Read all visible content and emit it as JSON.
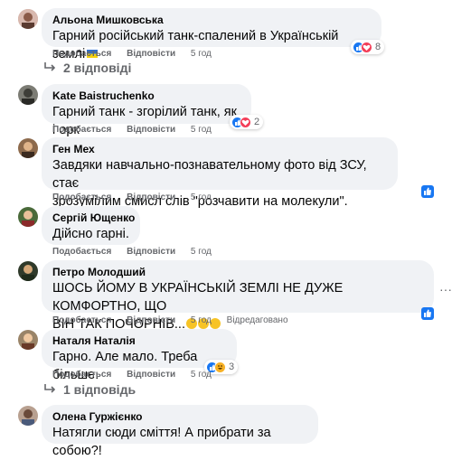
{
  "comments": [
    {
      "author": "Альона Мишковська",
      "text": "Гарний російський танк-спалений в Українській землі",
      "flag": "ukraine-flag",
      "actions": {
        "like": "Подобається",
        "reply": "Відповісти",
        "time": "5 год"
      },
      "reactions": {
        "count": "8",
        "icons": [
          "like-icon",
          "love-icon"
        ]
      },
      "replies": "2 відповіді"
    },
    {
      "author": "Kate Baistruchenko",
      "text": "Гарний танк - згорілий танк, як і орк",
      "actions": {
        "like": "Подобається",
        "reply": "Відповісти",
        "time": "5 год"
      },
      "reactions": {
        "count": "2",
        "icons": [
          "like-icon",
          "love-icon"
        ]
      }
    },
    {
      "author": "Ген Мех",
      "text_lines": [
        "Завдяки навчально-познавательному фото від ЗСУ, стає",
        "зрозумілим смисл слів \"розчавити на молекули\"."
      ],
      "actions": {
        "like": "Подобається",
        "reply": "Відповісти",
        "time": "5 год"
      }
    },
    {
      "author": "Сергій Ющенко",
      "text": "Дійсно гарні.",
      "actions": {
        "like": "Подобається",
        "reply": "Відповісти",
        "time": "5 год"
      }
    },
    {
      "author": "Петро Молодший",
      "text_lines": [
        "ШОСЬ ЙОМУ В УКРАЇНСЬКІЙ ЗЕМЛІ НЕ ДУЖЕ КОМФОРТНО, ЩО",
        "ВІН ТАК ПОЧОРНІВ..."
      ],
      "emojis": [
        "laughing-crying-emoji",
        "laughing-crying-emoji",
        "laughing-crying-emoji"
      ],
      "actions": {
        "like": "Подобається",
        "reply": "Відповісти",
        "time": "5 год",
        "edited": "Відредаговано"
      }
    },
    {
      "author": "Наталя Наталія",
      "text": "Гарно. Але мало. Треба більше.",
      "actions": {
        "like": "Подобається",
        "reply": "Відповісти",
        "time": "5 год"
      },
      "reactions": {
        "count": "3",
        "icons": [
          "like-icon",
          "haha-icon"
        ]
      },
      "replies": "1 відповідь"
    },
    {
      "author": "Олена Гуржієнко",
      "text": "Натягли сюди сміття! А прибрати за собою?!"
    }
  ],
  "colors": {
    "bubble": "#f0f2f5",
    "secondary": "#65676b",
    "like": "#1877f2",
    "love": "#f33e58",
    "haha": "#f7b125"
  }
}
